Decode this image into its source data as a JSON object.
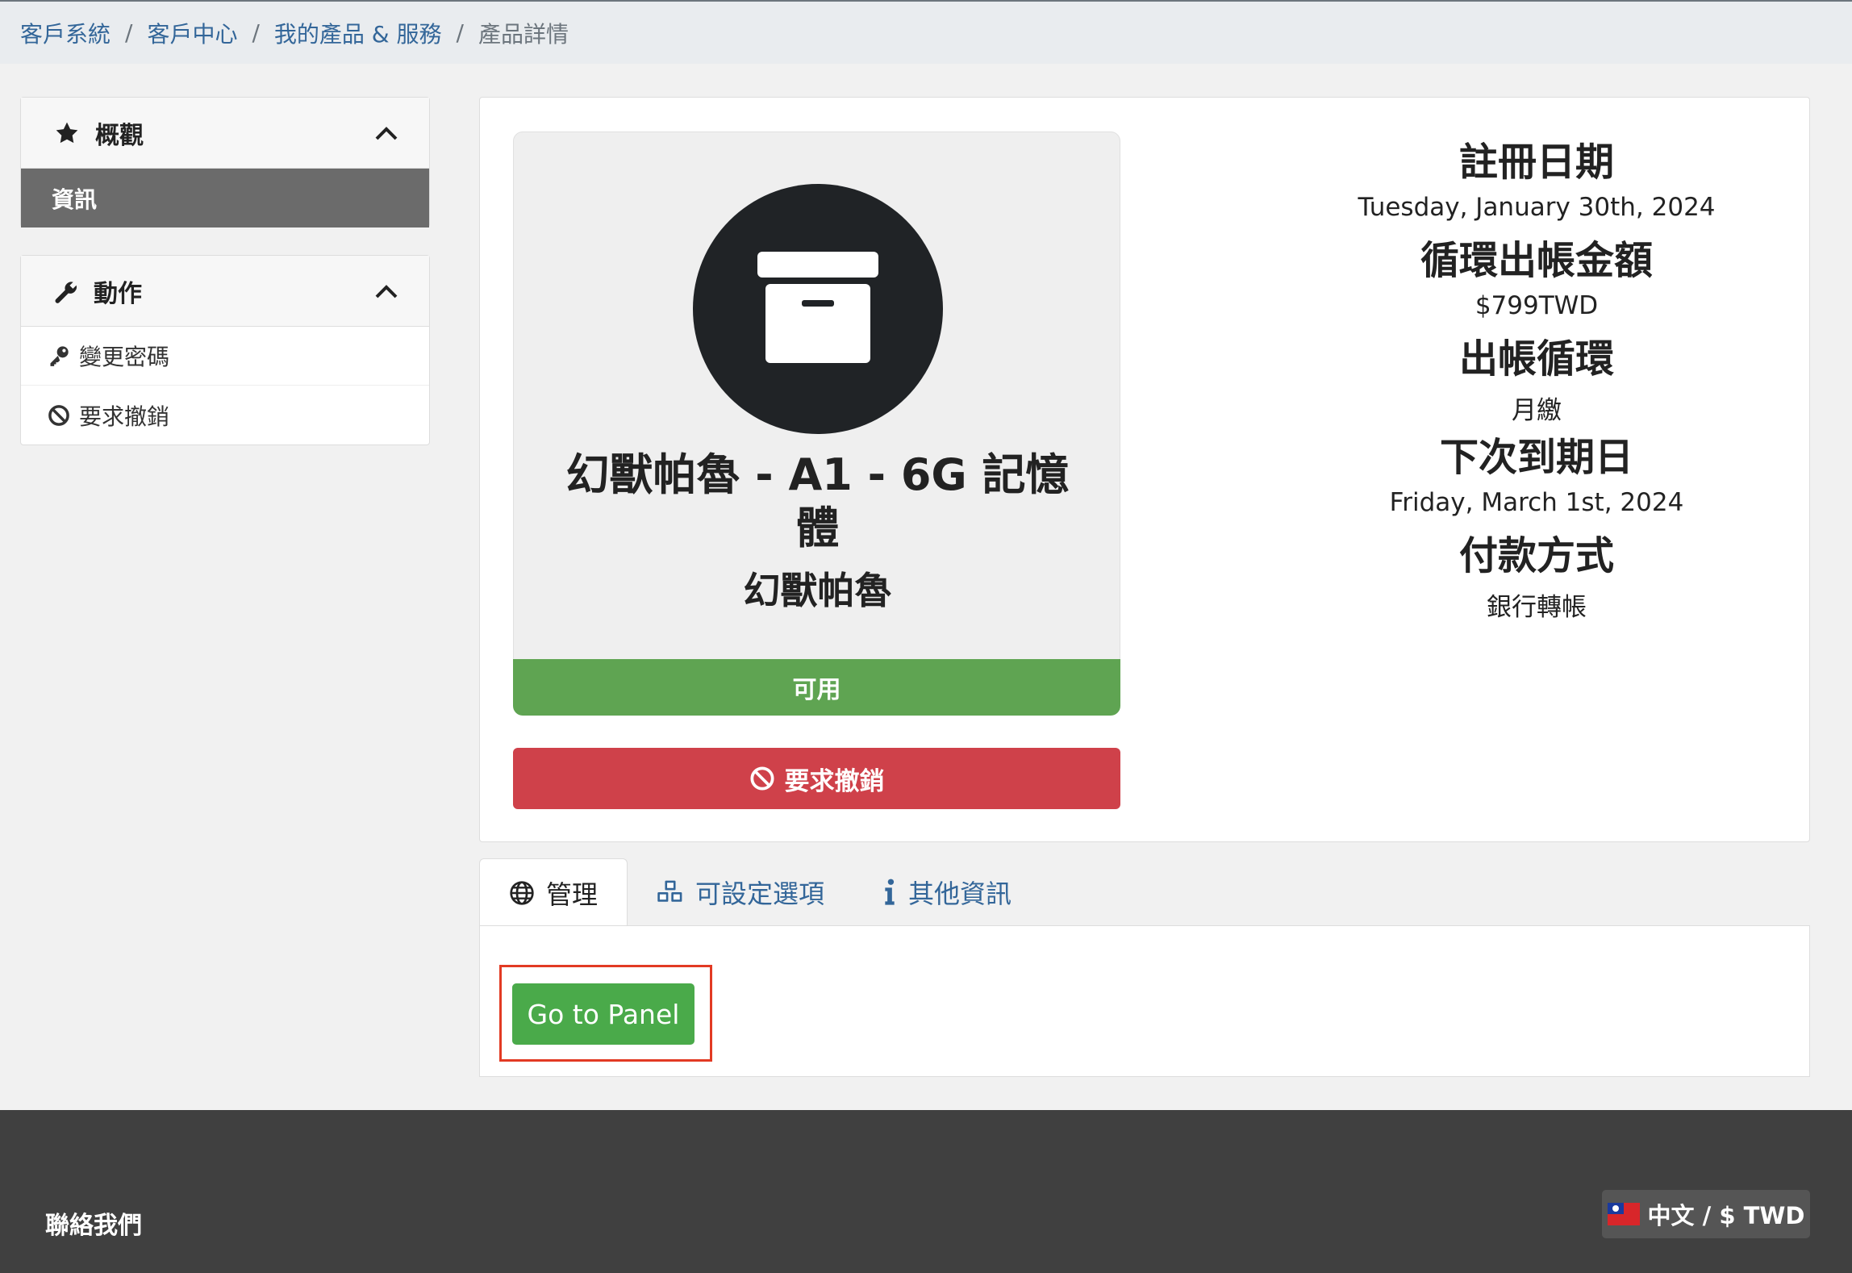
{
  "breadcrumb": {
    "items": [
      "客戶系統",
      "客戶中心",
      "我的產品 & 服務"
    ],
    "current": "產品詳情",
    "separator": "/"
  },
  "sidebar": {
    "overview": {
      "title": "概觀",
      "icon": "star-icon",
      "items": [
        {
          "label": "資訊",
          "active": true
        }
      ]
    },
    "actions": {
      "title": "動作",
      "icon": "wrench-icon",
      "items": [
        {
          "label": "變更密碼",
          "icon": "key-icon"
        },
        {
          "label": "要求撤銷",
          "icon": "ban-icon"
        }
      ]
    }
  },
  "product": {
    "icon": "archive-box-icon",
    "name": "幻獸帕魯 - A1 - 6G 記憶體",
    "group": "幻獸帕魯",
    "status": "可用",
    "cancel_label": "要求撤銷"
  },
  "details": {
    "registration_date_label": "註冊日期",
    "registration_date": "Tuesday, January 30th, 2024",
    "recurring_amount_label": "循環出帳金額",
    "recurring_amount": "$799TWD",
    "billing_cycle_label": "出帳循環",
    "billing_cycle": "月繳",
    "next_due_label": "下次到期日",
    "next_due": "Friday, March 1st, 2024",
    "payment_method_label": "付款方式",
    "payment_method": "銀行轉帳"
  },
  "tabs": [
    {
      "label": "管理",
      "icon": "globe-icon",
      "active": true
    },
    {
      "label": "可設定選項",
      "icon": "cubes-icon",
      "active": false
    },
    {
      "label": "其他資訊",
      "icon": "info-icon",
      "active": false
    }
  ],
  "manage": {
    "panel_button": "Go to Panel"
  },
  "footer": {
    "contact": "聯絡我們",
    "language": "中文 / $ TWD"
  },
  "colors": {
    "link": "#336699",
    "status_green": "#5fa452",
    "cancel_red": "#cf414a",
    "panel_button": "#4aaa4a",
    "highlight": "#e23a23",
    "footer": "#404040"
  }
}
